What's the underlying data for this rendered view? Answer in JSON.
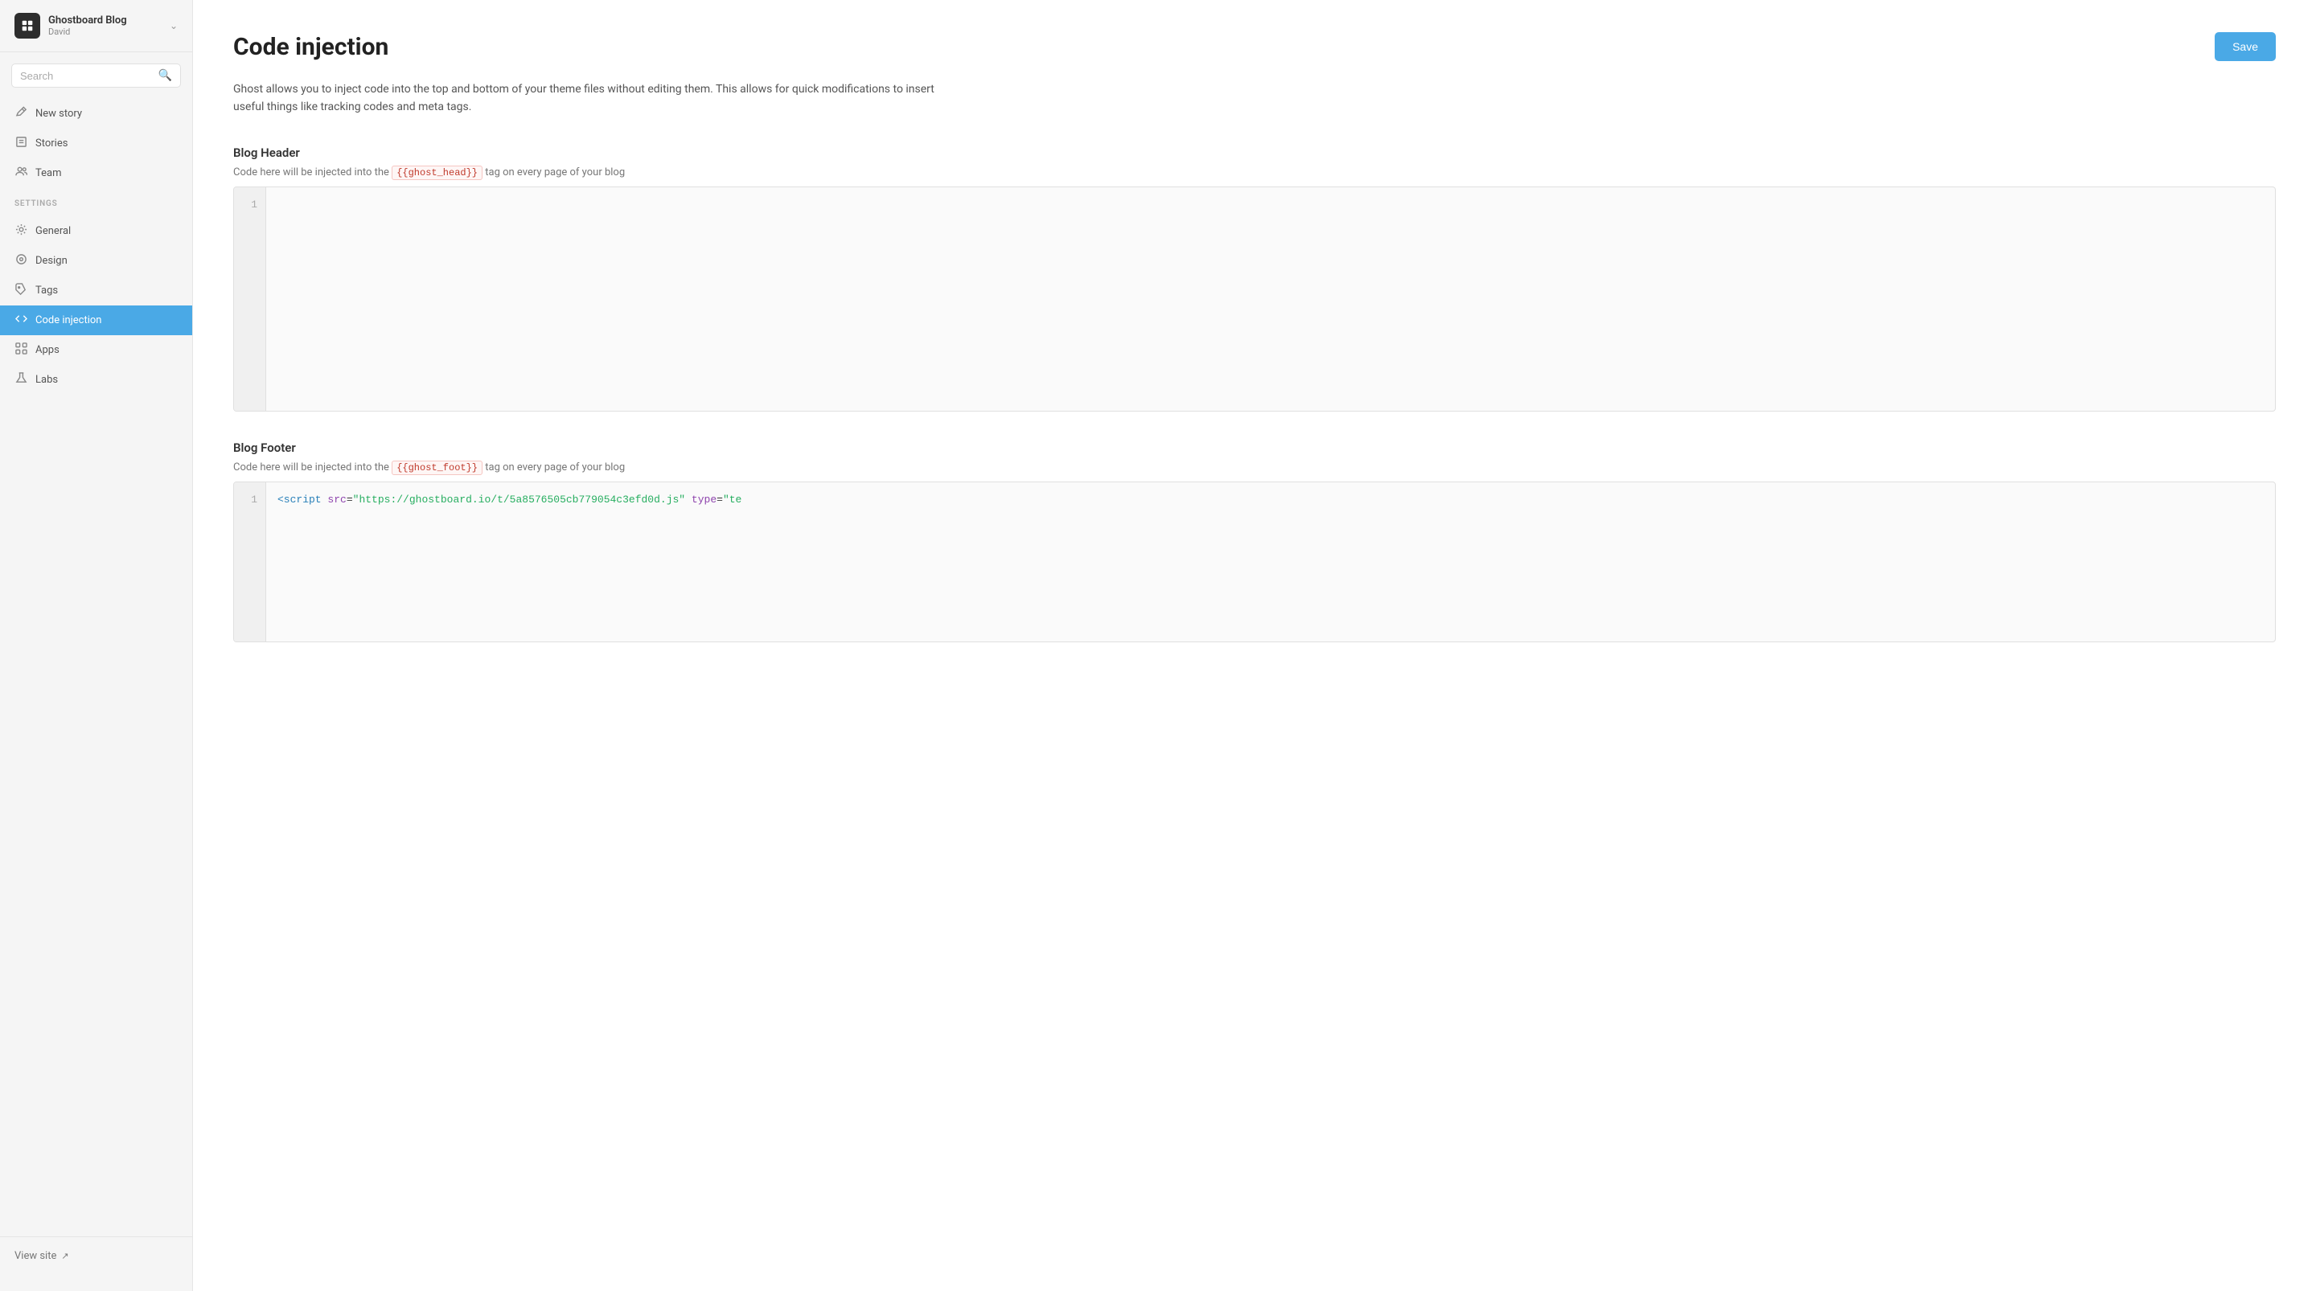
{
  "brand": {
    "name": "Ghostboard Blog",
    "user": "David"
  },
  "search": {
    "placeholder": "Search"
  },
  "nav": {
    "new_story": "New story",
    "stories": "Stories",
    "team": "Team"
  },
  "settings": {
    "label": "SETTINGS",
    "general": "General",
    "design": "Design",
    "tags": "Tags",
    "code_injection": "Code injection",
    "apps": "Apps",
    "labs": "Labs"
  },
  "sidebar_footer": {
    "view_site": "View site"
  },
  "page": {
    "title": "Code injection",
    "save_label": "Save",
    "description": "Ghost allows you to inject code into the top and bottom of your theme files without editing them. This allows for quick modifications to insert useful things like tracking codes and meta tags."
  },
  "blog_header": {
    "title": "Blog Header",
    "desc_before": "Code here will be injected into the",
    "tag": "{{ghost_head}}",
    "desc_after": "tag on every page of your blog"
  },
  "blog_footer": {
    "title": "Blog Footer",
    "desc_before": "Code here will be injected into the",
    "tag": "{{ghost_foot}}",
    "desc_after": "tag on every page of your blog",
    "code": "<script src=\"https://ghostboard.io/t/5a8576505cb779054c3efd0d.js\" type=\"te"
  }
}
